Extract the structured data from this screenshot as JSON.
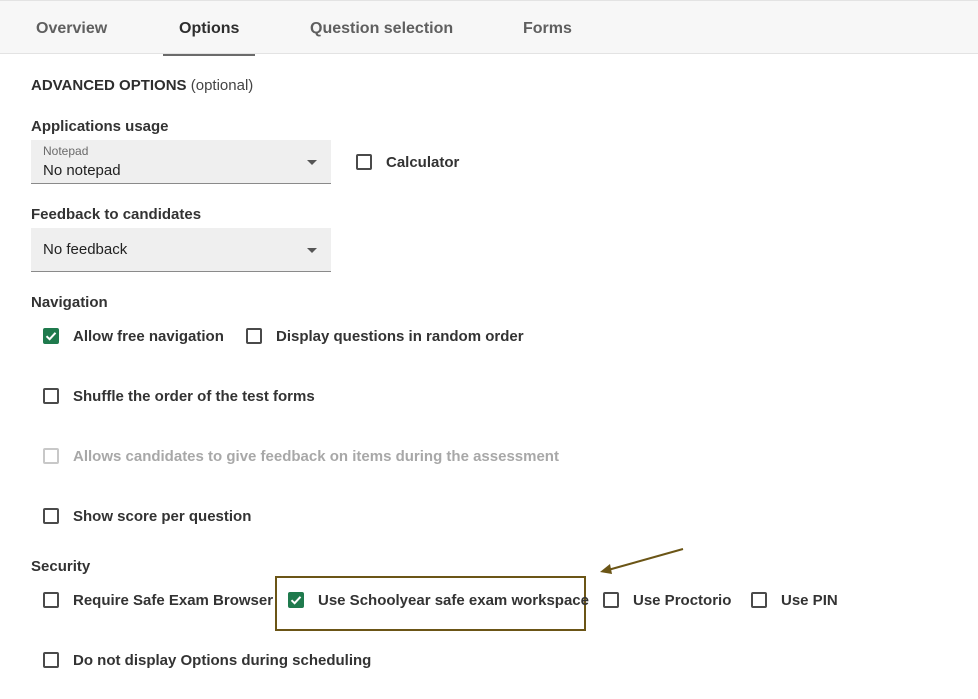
{
  "tabs": [
    {
      "label": "Overview",
      "active": false
    },
    {
      "label": "Options",
      "active": true
    },
    {
      "label": "Question selection",
      "active": false
    },
    {
      "label": "Forms",
      "active": false
    }
  ],
  "advanced": {
    "title": "ADVANCED OPTIONS",
    "optional": "(optional)"
  },
  "applications": {
    "label": "Applications usage",
    "notepad": {
      "caption": "Notepad",
      "value": "No notepad"
    },
    "calculator": {
      "label": "Calculator",
      "checked": false
    }
  },
  "feedback": {
    "label": "Feedback to candidates",
    "value": "No feedback"
  },
  "navigation": {
    "label": "Navigation",
    "free_navigation": {
      "label": "Allow free navigation",
      "checked": true
    },
    "random_order": {
      "label": "Display questions in random order",
      "checked": false
    },
    "shuffle_forms": {
      "label": "Shuffle the order of the test forms",
      "checked": false
    },
    "candidate_feedback": {
      "label": "Allows candidates to give feedback on items during the assessment",
      "checked": false,
      "disabled": true
    },
    "score_per_question": {
      "label": "Show score per question",
      "checked": false
    }
  },
  "security": {
    "label": "Security",
    "safe_exam_browser": {
      "label": "Require Safe Exam Browser",
      "checked": false
    },
    "schoolyear": {
      "label": "Use Schoolyear safe exam workspace",
      "checked": true
    },
    "proctorio": {
      "label": "Use Proctorio",
      "checked": false
    },
    "pin": {
      "label": "Use PIN",
      "checked": false
    },
    "hide_options": {
      "label": "Do not display Options during scheduling",
      "checked": false
    }
  },
  "colors": {
    "checked": "#1f7a4d",
    "highlight": "#6b5516"
  }
}
